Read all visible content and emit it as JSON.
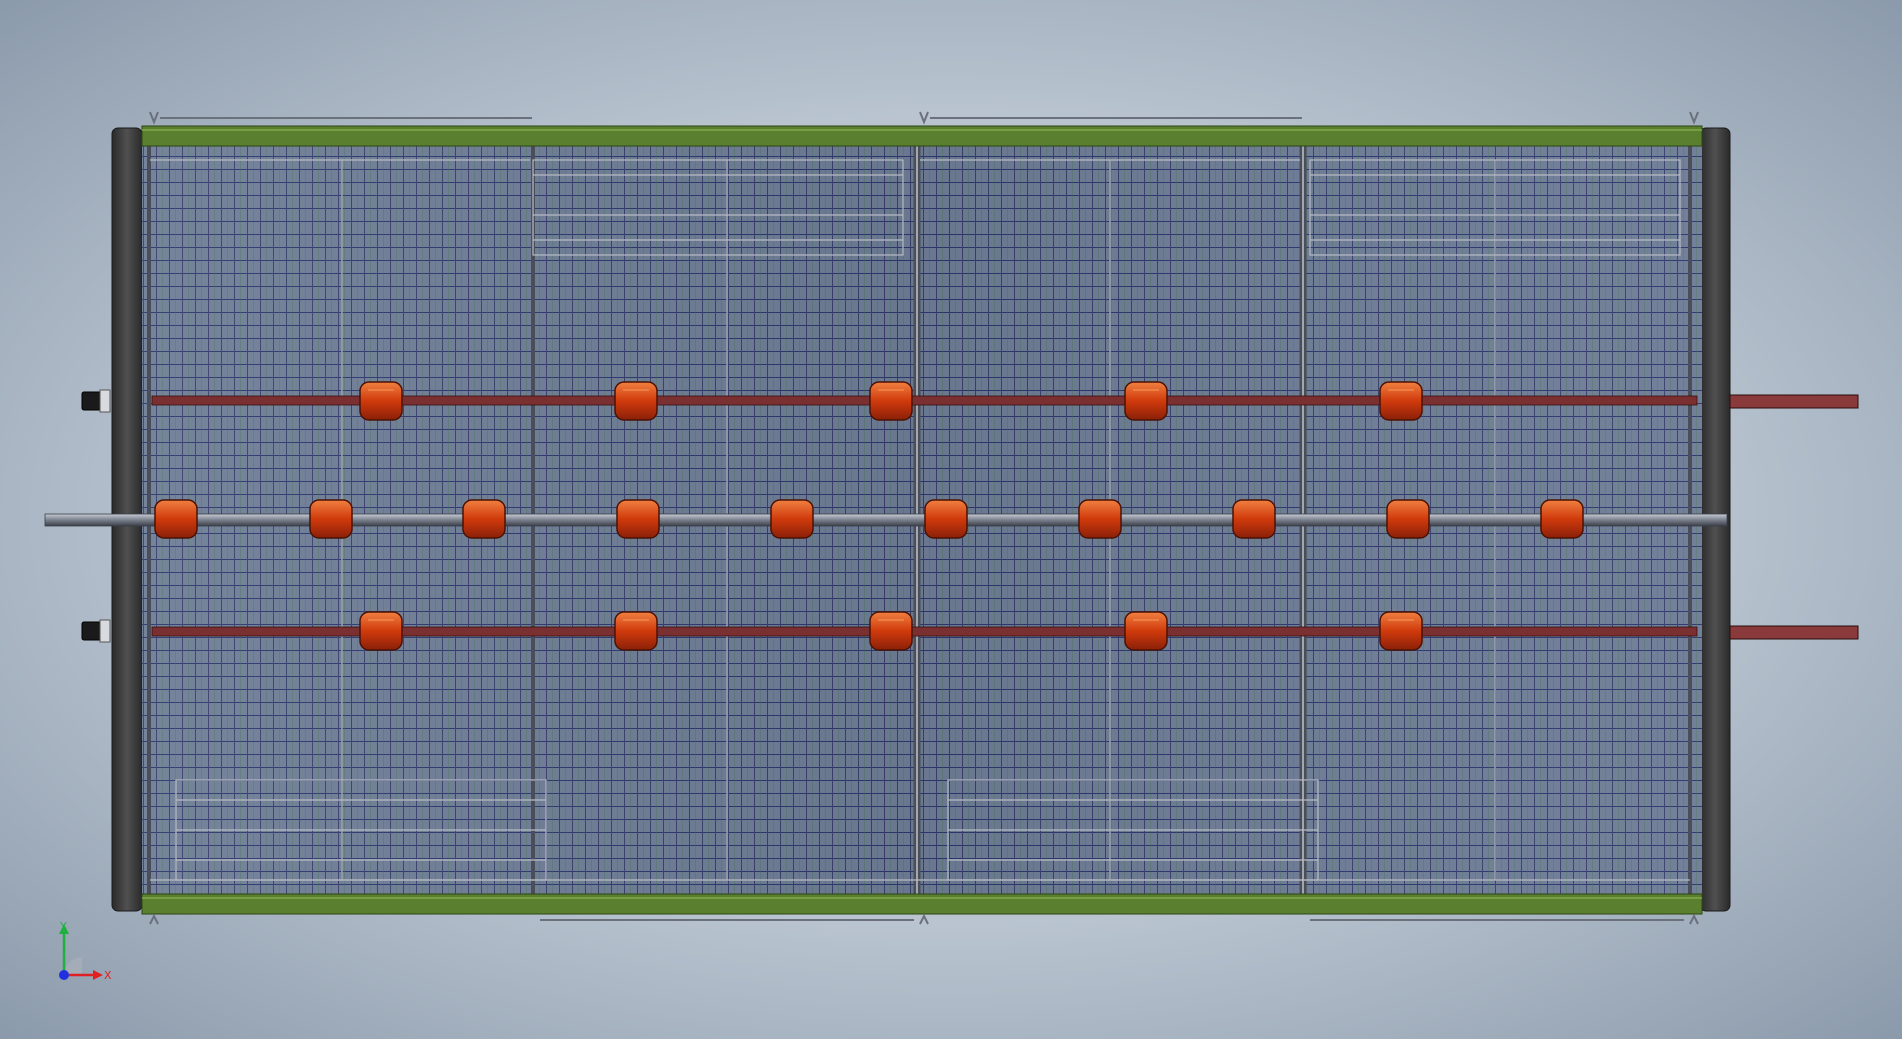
{
  "viewport": {
    "background_top": "#8b9aab",
    "background_center": "#d4dbe3"
  },
  "model": {
    "rail_color": "#5a7f2e",
    "side_panel_color": "#3a3a3a",
    "mesh_color": "#5a6a8a",
    "mesh_accent": "#2a3a8a",
    "bar_color": "#7a3030",
    "clamp_color": "#d04010",
    "rod_color": "#8a8e98"
  },
  "triad": {
    "x_label": "X",
    "y_label": "Y",
    "x_color": "#e02020",
    "y_color": "#20b040",
    "z_color": "#2030e0"
  }
}
